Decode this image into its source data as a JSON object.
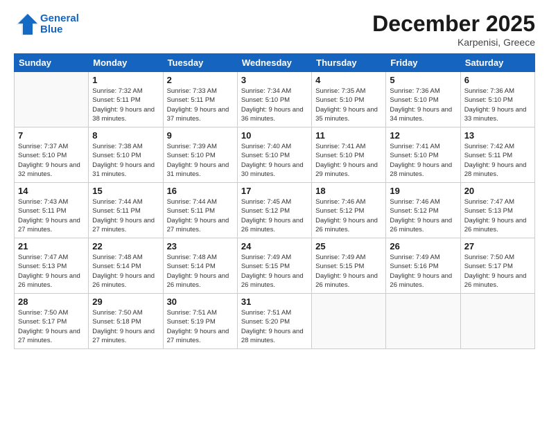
{
  "header": {
    "logo_line1": "General",
    "logo_line2": "Blue",
    "month": "December 2025",
    "location": "Karpenisi, Greece"
  },
  "weekdays": [
    "Sunday",
    "Monday",
    "Tuesday",
    "Wednesday",
    "Thursday",
    "Friday",
    "Saturday"
  ],
  "weeks": [
    [
      {
        "day": "",
        "sunrise": "",
        "sunset": "",
        "daylight": "",
        "empty": true
      },
      {
        "day": "1",
        "sunrise": "7:32 AM",
        "sunset": "5:11 PM",
        "daylight": "9 hours and 38 minutes.",
        "empty": false
      },
      {
        "day": "2",
        "sunrise": "7:33 AM",
        "sunset": "5:11 PM",
        "daylight": "9 hours and 37 minutes.",
        "empty": false
      },
      {
        "day": "3",
        "sunrise": "7:34 AM",
        "sunset": "5:10 PM",
        "daylight": "9 hours and 36 minutes.",
        "empty": false
      },
      {
        "day": "4",
        "sunrise": "7:35 AM",
        "sunset": "5:10 PM",
        "daylight": "9 hours and 35 minutes.",
        "empty": false
      },
      {
        "day": "5",
        "sunrise": "7:36 AM",
        "sunset": "5:10 PM",
        "daylight": "9 hours and 34 minutes.",
        "empty": false
      },
      {
        "day": "6",
        "sunrise": "7:36 AM",
        "sunset": "5:10 PM",
        "daylight": "9 hours and 33 minutes.",
        "empty": false
      }
    ],
    [
      {
        "day": "7",
        "sunrise": "7:37 AM",
        "sunset": "5:10 PM",
        "daylight": "9 hours and 32 minutes.",
        "empty": false
      },
      {
        "day": "8",
        "sunrise": "7:38 AM",
        "sunset": "5:10 PM",
        "daylight": "9 hours and 31 minutes.",
        "empty": false
      },
      {
        "day": "9",
        "sunrise": "7:39 AM",
        "sunset": "5:10 PM",
        "daylight": "9 hours and 31 minutes.",
        "empty": false
      },
      {
        "day": "10",
        "sunrise": "7:40 AM",
        "sunset": "5:10 PM",
        "daylight": "9 hours and 30 minutes.",
        "empty": false
      },
      {
        "day": "11",
        "sunrise": "7:41 AM",
        "sunset": "5:10 PM",
        "daylight": "9 hours and 29 minutes.",
        "empty": false
      },
      {
        "day": "12",
        "sunrise": "7:41 AM",
        "sunset": "5:10 PM",
        "daylight": "9 hours and 28 minutes.",
        "empty": false
      },
      {
        "day": "13",
        "sunrise": "7:42 AM",
        "sunset": "5:11 PM",
        "daylight": "9 hours and 28 minutes.",
        "empty": false
      }
    ],
    [
      {
        "day": "14",
        "sunrise": "7:43 AM",
        "sunset": "5:11 PM",
        "daylight": "9 hours and 27 minutes.",
        "empty": false
      },
      {
        "day": "15",
        "sunrise": "7:44 AM",
        "sunset": "5:11 PM",
        "daylight": "9 hours and 27 minutes.",
        "empty": false
      },
      {
        "day": "16",
        "sunrise": "7:44 AM",
        "sunset": "5:11 PM",
        "daylight": "9 hours and 27 minutes.",
        "empty": false
      },
      {
        "day": "17",
        "sunrise": "7:45 AM",
        "sunset": "5:12 PM",
        "daylight": "9 hours and 26 minutes.",
        "empty": false
      },
      {
        "day": "18",
        "sunrise": "7:46 AM",
        "sunset": "5:12 PM",
        "daylight": "9 hours and 26 minutes.",
        "empty": false
      },
      {
        "day": "19",
        "sunrise": "7:46 AM",
        "sunset": "5:12 PM",
        "daylight": "9 hours and 26 minutes.",
        "empty": false
      },
      {
        "day": "20",
        "sunrise": "7:47 AM",
        "sunset": "5:13 PM",
        "daylight": "9 hours and 26 minutes.",
        "empty": false
      }
    ],
    [
      {
        "day": "21",
        "sunrise": "7:47 AM",
        "sunset": "5:13 PM",
        "daylight": "9 hours and 26 minutes.",
        "empty": false
      },
      {
        "day": "22",
        "sunrise": "7:48 AM",
        "sunset": "5:14 PM",
        "daylight": "9 hours and 26 minutes.",
        "empty": false
      },
      {
        "day": "23",
        "sunrise": "7:48 AM",
        "sunset": "5:14 PM",
        "daylight": "9 hours and 26 minutes.",
        "empty": false
      },
      {
        "day": "24",
        "sunrise": "7:49 AM",
        "sunset": "5:15 PM",
        "daylight": "9 hours and 26 minutes.",
        "empty": false
      },
      {
        "day": "25",
        "sunrise": "7:49 AM",
        "sunset": "5:15 PM",
        "daylight": "9 hours and 26 minutes.",
        "empty": false
      },
      {
        "day": "26",
        "sunrise": "7:49 AM",
        "sunset": "5:16 PM",
        "daylight": "9 hours and 26 minutes.",
        "empty": false
      },
      {
        "day": "27",
        "sunrise": "7:50 AM",
        "sunset": "5:17 PM",
        "daylight": "9 hours and 26 minutes.",
        "empty": false
      }
    ],
    [
      {
        "day": "28",
        "sunrise": "7:50 AM",
        "sunset": "5:17 PM",
        "daylight": "9 hours and 27 minutes.",
        "empty": false
      },
      {
        "day": "29",
        "sunrise": "7:50 AM",
        "sunset": "5:18 PM",
        "daylight": "9 hours and 27 minutes.",
        "empty": false
      },
      {
        "day": "30",
        "sunrise": "7:51 AM",
        "sunset": "5:19 PM",
        "daylight": "9 hours and 27 minutes.",
        "empty": false
      },
      {
        "day": "31",
        "sunrise": "7:51 AM",
        "sunset": "5:20 PM",
        "daylight": "9 hours and 28 minutes.",
        "empty": false
      },
      {
        "day": "",
        "sunrise": "",
        "sunset": "",
        "daylight": "",
        "empty": true
      },
      {
        "day": "",
        "sunrise": "",
        "sunset": "",
        "daylight": "",
        "empty": true
      },
      {
        "day": "",
        "sunrise": "",
        "sunset": "",
        "daylight": "",
        "empty": true
      }
    ]
  ]
}
